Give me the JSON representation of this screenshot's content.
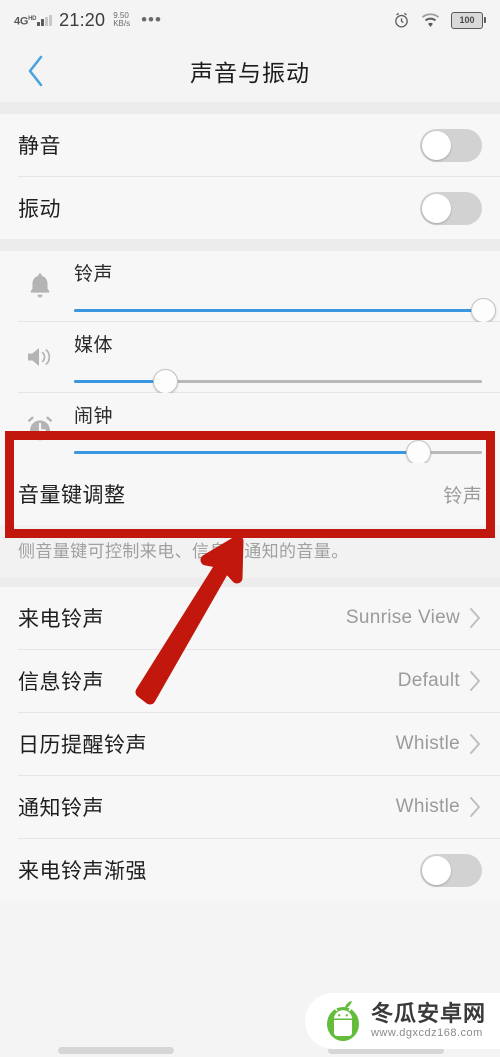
{
  "statusbar": {
    "network": "4G",
    "network_sup": "HD",
    "time": "21:20",
    "speed_value": "9.50",
    "speed_unit": "KB/s",
    "overflow": "•••",
    "alarm_icon": "alarm-clock-icon",
    "wifi_icon": "wifi-icon",
    "battery": "100"
  },
  "header": {
    "back_icon": "chevron-left-icon",
    "title": "声音与振动"
  },
  "toggles_section": [
    {
      "label": "静音",
      "state": "off"
    },
    {
      "label": "振动",
      "state": "off"
    }
  ],
  "volume_sliders": [
    {
      "icon": "bell-icon",
      "label": "铃声",
      "percent": 100
    },
    {
      "icon": "speaker-icon",
      "label": "媒体",
      "percent": 22
    },
    {
      "icon": "alarm-clock-icon",
      "label": "闹钟",
      "percent": 84
    }
  ],
  "volume_key": {
    "label": "音量键调整",
    "value": "铃声",
    "description": "侧音量键可控制来电、信息和通知的音量。"
  },
  "ringtone_rows": [
    {
      "label": "来电铃声",
      "value": "Sunrise View",
      "chevron": "chevron-right-icon"
    },
    {
      "label": "信息铃声",
      "value": "Default",
      "chevron": "chevron-right-icon"
    },
    {
      "label": "日历提醒铃声",
      "value": "Whistle",
      "chevron": "chevron-right-icon"
    },
    {
      "label": "通知铃声",
      "value": "Whistle",
      "chevron": "chevron-right-icon"
    }
  ],
  "last_toggle": {
    "label": "来电铃声渐强",
    "state": "off"
  },
  "annotation": {
    "highlight_color": "#c1170c",
    "highlight_target": "闹钟",
    "arrow_color": "#c1170c"
  },
  "watermark": {
    "name": "冬瓜安卓网",
    "url": "www.dgxcdz168.com",
    "logo_icon": "android-melon-logo-icon"
  }
}
